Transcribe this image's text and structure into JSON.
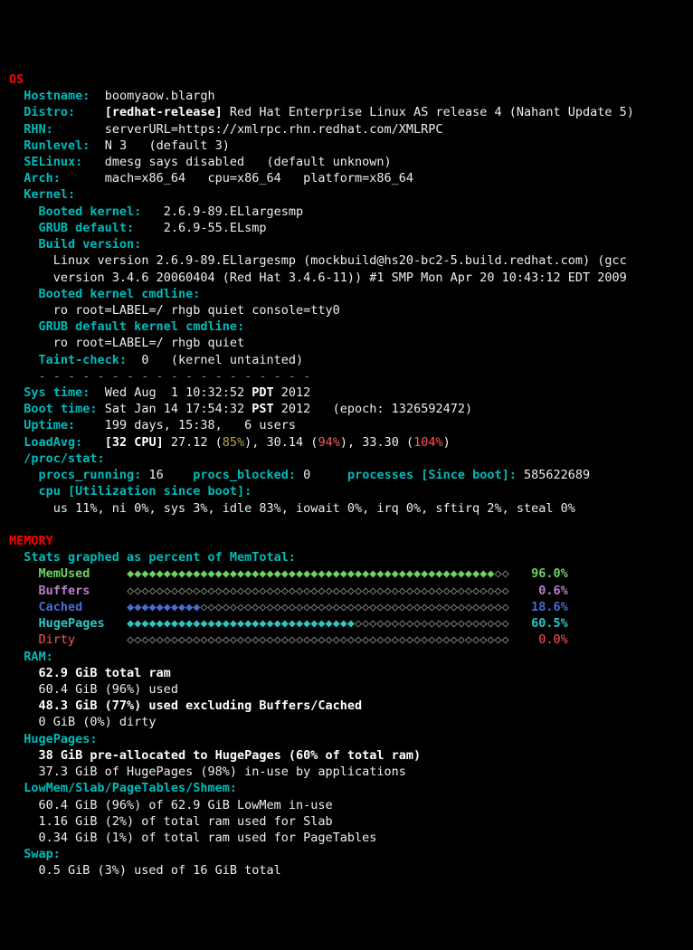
{
  "os_hdr": "OS",
  "hostname_k": "Hostname:",
  "hostname_v": "boomyaow.blargh",
  "distro_k": "Distro:",
  "distro_tag": "[redhat-release]",
  "distro_v": "Red Hat Enterprise Linux AS release 4 (Nahant Update 5)",
  "rhn_k": "RHN:",
  "rhn_v": "serverURL=https://xmlrpc.rhn.redhat.com/XMLRPC",
  "runlevel_k": "Runlevel:",
  "runlevel_v": "N 3   (default 3)",
  "selinux_k": "SELinux:",
  "selinux_v": "dmesg says disabled   (default unknown)",
  "arch_k": "Arch:",
  "arch_v": "mach=x86_64   cpu=x86_64   platform=x86_64",
  "kernel_k": "Kernel:",
  "booted_k": "Booted kernel:",
  "booted_v": "2.6.9-89.ELlargesmp",
  "grubdef_k": "GRUB default:",
  "grubdef_v": "2.6.9-55.ELsmp",
  "buildv_k": "Build version:",
  "buildv_l1": "Linux version 2.6.9-89.ELlargesmp (mockbuild@hs20-bc2-5.build.redhat.com) (gcc",
  "buildv_l2": "version 3.4.6 20060404 (Red Hat 3.4.6-11)) #1 SMP Mon Apr 20 10:43:12 EDT 2009",
  "bcmd_k": "Booted kernel cmdline:",
  "bcmd_v": "ro root=LABEL=/ rhgb quiet console=tty0",
  "gcmd_k": "GRUB default kernel cmdline:",
  "gcmd_v": "ro root=LABEL=/ rhgb quiet",
  "taint_k": "Taint-check:",
  "taint_v": "0   (kernel untainted)",
  "sep": "- - - - - - - - - - - - - - - - - - -",
  "systime_k": "Sys time:",
  "systime_v1": "Wed Aug  1 10:32:52 ",
  "systime_tz": "PDT",
  "systime_v2": " 2012",
  "boottime_k": "Boot time:",
  "boottime_v1": "Sat Jan 14 17:54:32 ",
  "boottime_tz": "PST",
  "boottime_v2": " 2012   (epoch: 1326592472)",
  "uptime_k": "Uptime:",
  "uptime_v": "199 days, 15:38,   6 users",
  "loadavg_k": "LoadAvg:",
  "loadavg_tag": "[32 CPU]",
  "loadavg_1": "27.12 (",
  "loadavg_1p": "85%",
  "loadavg_1e": "), 30.14 (",
  "loadavg_2p": "94%",
  "loadavg_2e": "), 33.30 (",
  "loadavg_3p": "104%",
  "loadavg_3e": ")",
  "procstat_k": "/proc/stat:",
  "procs_run_k": "procs_running:",
  "procs_run_v": "16",
  "procs_blk_k": "procs_blocked:",
  "procs_blk_v": "0",
  "procs_boot_k": "processes [Since boot]:",
  "procs_boot_v": "585622689",
  "cpu_k": "cpu [Utilization since boot]:",
  "cpu_line": "us 11%, ni 0%, sys 3%, idle 83%, iowait 0%, irq 0%, sftirq 2%, steal 0%",
  "mem_hdr": "MEMORY",
  "memgraph_k": "Stats graphed as percent of MemTotal:",
  "bars": {
    "memused": {
      "label": "MemUsed",
      "filled": 50,
      "empty": 2,
      "pct": "96.0%"
    },
    "buffers": {
      "label": "Buffers",
      "filled": 0,
      "empty": 52,
      "pct": "0.6%"
    },
    "cached": {
      "label": "Cached",
      "filled": 10,
      "empty": 42,
      "pct": "18.6%"
    },
    "hugepages": {
      "label": "HugePages",
      "filled": 31,
      "empty": 21,
      "pct": "60.5%"
    },
    "dirty": {
      "label": "Dirty",
      "filled": 0,
      "empty": 52,
      "pct": "0.0%"
    }
  },
  "ram_k": "RAM:",
  "ram_l1": "62.9 GiB total ram",
  "ram_l2": "60.4 GiB (96%) used",
  "ram_l3": "48.3 GiB (77%) used excluding Buffers/Cached",
  "ram_l4": "0 GiB (0%) dirty",
  "hp_k": "HugePages:",
  "hp_l1": "38 GiB pre-allocated to HugePages (60% of total ram)",
  "hp_l2": "37.3 GiB of HugePages (98%) in-use by applications",
  "low_k": "LowMem/Slab/PageTables/Shmem:",
  "low_l1": "60.4 GiB (96%) of 62.9 GiB LowMem in-use",
  "low_l2": "1.16 GiB (2%) of total ram used for Slab",
  "low_l3": "0.34 GiB (1%) of total ram used for PageTables",
  "swap_k": "Swap:",
  "swap_l1": "0.5 GiB (3%) used of 16 GiB total"
}
